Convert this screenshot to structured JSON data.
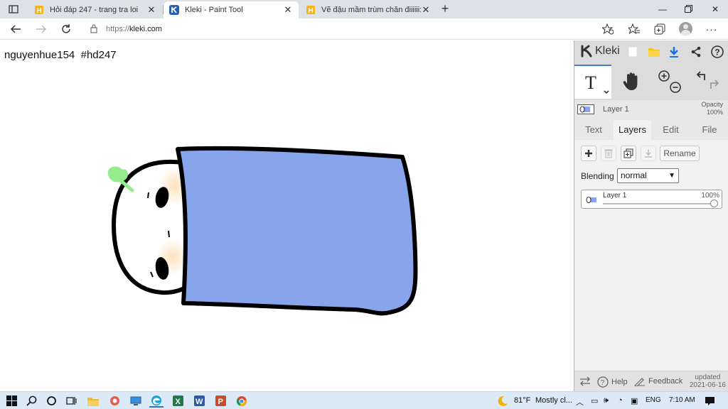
{
  "browser": {
    "tabs": [
      {
        "title": "Hỏi đáp 247 - trang tra loi",
        "active": false
      },
      {
        "title": "Kleki - Paint Tool",
        "active": true
      },
      {
        "title": "Vẽ đậu mầm trùm chăn điiiiii:>",
        "active": false
      }
    ],
    "new_tab": "+",
    "url_prefix": "https://",
    "url_host": "kleki.com"
  },
  "canvas": {
    "signature": "nguyenhue154  #hd247"
  },
  "kleki": {
    "logo": "Kleki",
    "layer_mini_name": "Layer 1",
    "opacity_label": "Opacity",
    "opacity_value": "100%",
    "tabs": [
      "Text",
      "Layers",
      "Edit",
      "File"
    ],
    "active_tab": "Layers",
    "rename_label": "Rename",
    "blending_label": "Blending",
    "blending_value": "normal",
    "layer": {
      "name": "Layer 1",
      "opacity": "100%",
      "opacity_fraction": 1.0
    },
    "footer": {
      "help": "Help",
      "feedback": "Feedback",
      "updated_label": "updated",
      "updated_date": "2021-06-16"
    },
    "colors": {
      "blanket": "#88a4ea",
      "sprout": "#96ec8c",
      "accent": "#3f7bd2"
    }
  },
  "taskbar": {
    "weather_temp": "81°F",
    "weather_text": "Mostly cl...",
    "language": "ENG",
    "time": "7:10 AM"
  }
}
